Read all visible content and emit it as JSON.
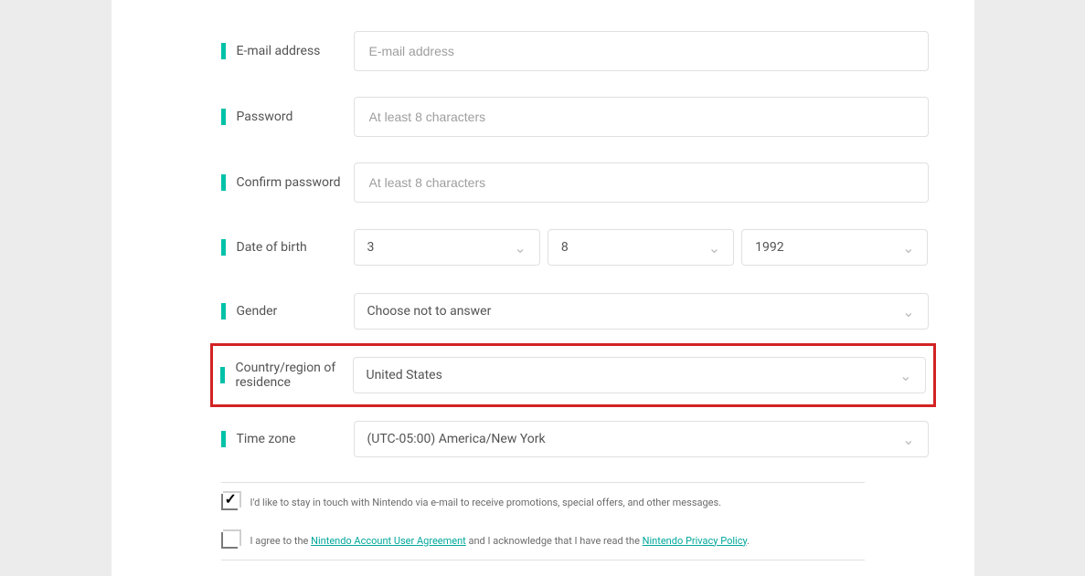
{
  "fields": {
    "email": {
      "label": "E-mail address",
      "placeholder": "E-mail address",
      "value": ""
    },
    "password": {
      "label": "Password",
      "placeholder": "At least 8 characters",
      "value": ""
    },
    "confirm": {
      "label": "Confirm password",
      "placeholder": "At least 8 characters",
      "value": ""
    },
    "dob": {
      "label": "Date of birth",
      "month": "3",
      "day": "8",
      "year": "1992"
    },
    "gender": {
      "label": "Gender",
      "value": "Choose not to answer"
    },
    "country": {
      "label": "Country/region of residence",
      "value": "United States"
    },
    "timezone": {
      "label": "Time zone",
      "value": "(UTC-05:00) America/New York"
    }
  },
  "checkboxes": {
    "marketing": {
      "checked": true,
      "text": "I'd like to stay in touch with Nintendo via e-mail to receive promotions, special offers, and other messages."
    },
    "agreement": {
      "checked": false,
      "before": "I agree to the ",
      "link1": "Nintendo Account User Agreement",
      "mid": " and I acknowledge that I have read the ",
      "link2": "Nintendo Privacy Policy",
      "after": "."
    }
  }
}
